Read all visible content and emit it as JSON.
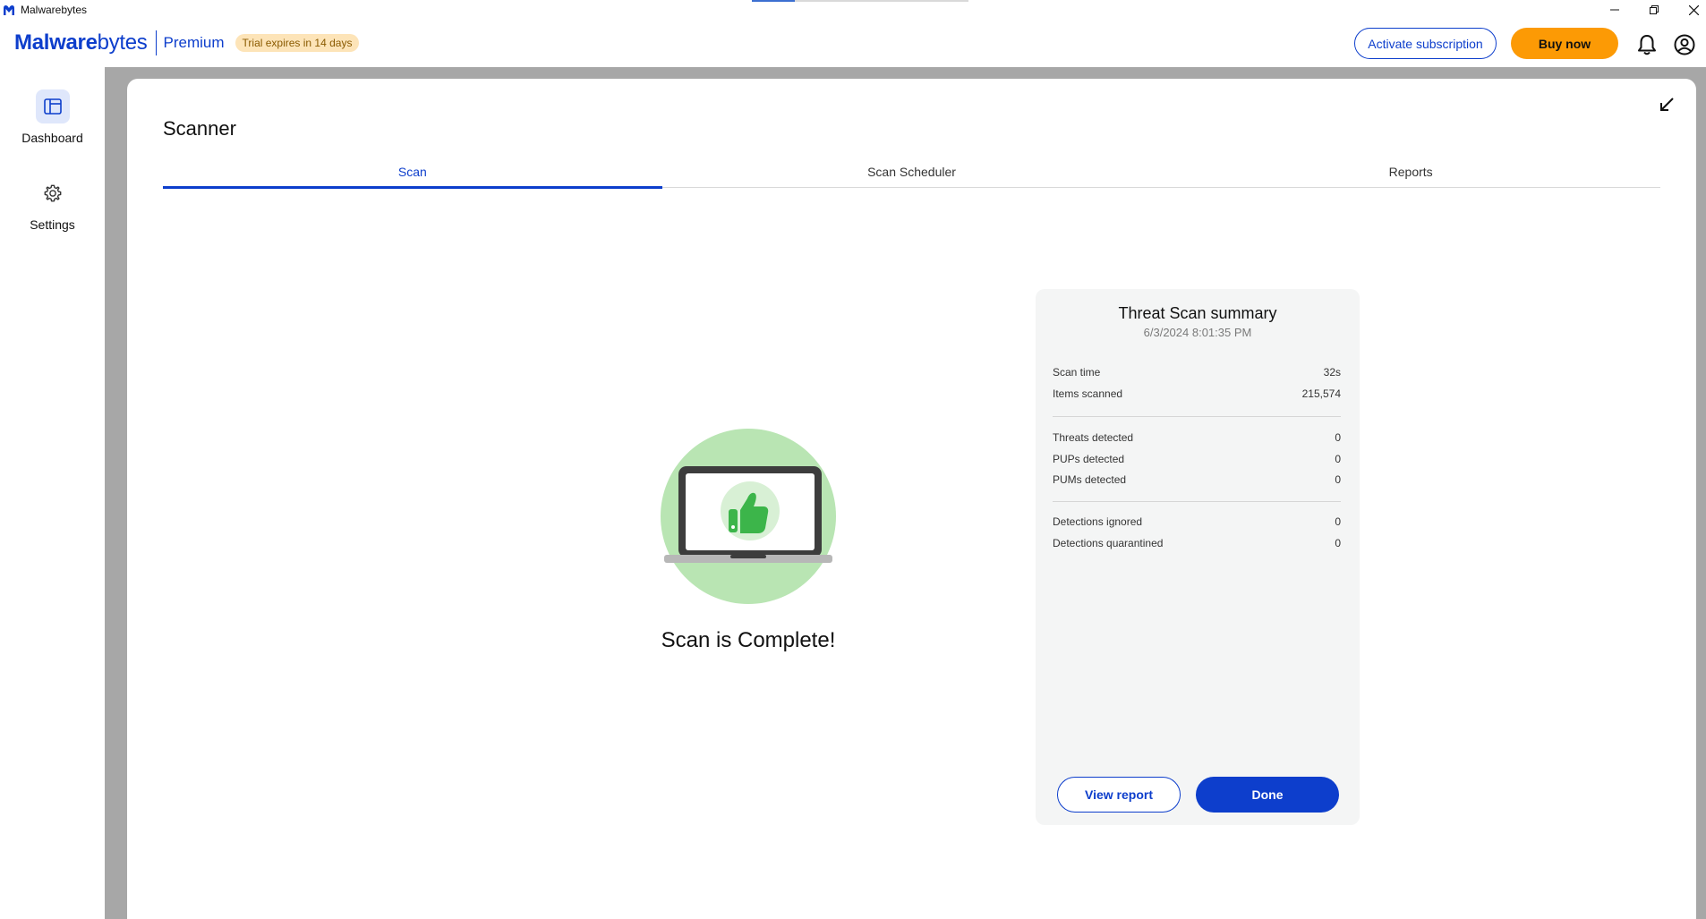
{
  "window": {
    "title": "Malwarebytes",
    "controls": [
      "minimize-icon",
      "restore-icon",
      "close-icon"
    ]
  },
  "header": {
    "brand_bold": "Malware",
    "brand_light": "bytes",
    "edition": "Premium",
    "trial_badge": "Trial expires in 14 days",
    "activate_label": "Activate subscription",
    "buy_label": "Buy now",
    "icons": [
      "bell-icon",
      "account-icon"
    ],
    "colors": {
      "brand": "#0D3ECC",
      "buy": "#FC9A05",
      "trial_badge_bg": "#FDE4B8"
    }
  },
  "sidebar": {
    "items": [
      {
        "label": "Dashboard",
        "icon": "dashboard-icon",
        "active": true
      },
      {
        "label": "Settings",
        "icon": "gear-icon",
        "active": false
      }
    ]
  },
  "main": {
    "title": "Scanner",
    "tabs": [
      {
        "label": "Scan",
        "active": true
      },
      {
        "label": "Scan Scheduler",
        "active": false
      },
      {
        "label": "Reports",
        "active": false
      }
    ],
    "status_text": "Scan is Complete!",
    "illustration_icons": [
      "laptop-icon",
      "thumbs-up-icon"
    ]
  },
  "summary": {
    "title": "Threat Scan summary",
    "date": "6/3/2024 8:01:35 PM",
    "groups": [
      [
        {
          "label": "Scan time",
          "value": "32s"
        },
        {
          "label": "Items scanned",
          "value": "215,574"
        }
      ],
      [
        {
          "label": "Threats detected",
          "value": "0"
        },
        {
          "label": "PUPs detected",
          "value": "0"
        },
        {
          "label": "PUMs detected",
          "value": "0"
        }
      ],
      [
        {
          "label": "Detections ignored",
          "value": "0"
        },
        {
          "label": "Detections quarantined",
          "value": "0"
        }
      ]
    ],
    "view_report_label": "View report",
    "done_label": "Done"
  }
}
